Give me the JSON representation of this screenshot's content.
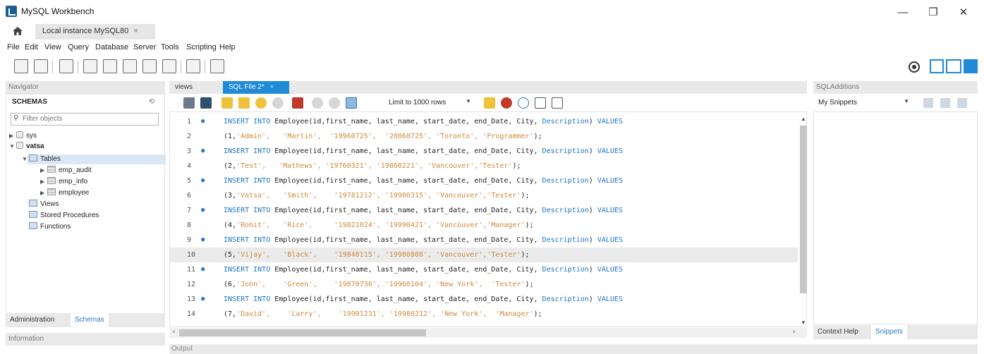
{
  "window": {
    "title": "MySQL Workbench",
    "minimize": "—",
    "maximize": "❐",
    "close": "✕"
  },
  "connection_tab": {
    "label": "Local instance MySQL80",
    "close": "×"
  },
  "menu": [
    "File",
    "Edit",
    "View",
    "Query",
    "Database",
    "Server",
    "Tools",
    "Scripting",
    "Help"
  ],
  "navigator": {
    "header": "Navigator",
    "schemas_title": "SCHEMAS",
    "filter_placeholder": "Filter objects",
    "tree": {
      "sys": "sys",
      "vatsa": "vatsa",
      "tables": "Tables",
      "emp_audit": "emp_audit",
      "emp_info": "emp_info",
      "employee": "employee",
      "views": "Views",
      "stored_procedures": "Stored Procedures",
      "functions": "Functions"
    },
    "tabs": {
      "administration": "Administration",
      "schemas": "Schemas"
    },
    "information": "Information"
  },
  "editor_tabs": {
    "views": "views",
    "sql_file": "SQL File 2*",
    "close": "×"
  },
  "editor_toolbar": {
    "limit": "Limit to 1000 rows"
  },
  "sql": {
    "insert_kw": "INSERT INTO",
    "insert_rest": " Employee(id,first_name, last_name, start_date, end_Date, City, ",
    "description_kw": "Description",
    "values_kw": "VALUES",
    "lines": [
      {
        "num": "1",
        "dot": true
      },
      {
        "num": "2",
        "id": "(1,",
        "vals": [
          "'Admin',",
          "   'Martin',",
          "  '19960725',",
          "  '20060725',",
          " 'Toronto',",
          " 'Programmer'"
        ],
        "end": ");"
      },
      {
        "num": "3",
        "dot": true
      },
      {
        "num": "4",
        "id": "(2,",
        "vals": [
          "'Test',",
          "   'Mathews',",
          " '19760321',",
          " '19860221',",
          " 'Vancouver',",
          "'Tester'"
        ],
        "end": ");"
      },
      {
        "num": "5",
        "dot": true
      },
      {
        "num": "6",
        "id": "(3,",
        "vals": [
          "'Vatsa',",
          "   'Smith',",
          "    '19781212',",
          " '19900315',",
          " 'Vancouver',",
          "'Tester'"
        ],
        "end": ");"
      },
      {
        "num": "7",
        "dot": true
      },
      {
        "num": "8",
        "id": "(4,",
        "vals": [
          "'Rohit',",
          "   'Rice',",
          "     '19821024',",
          " '19990421',",
          " 'Vancouver',",
          "'Manager'"
        ],
        "end": ");"
      },
      {
        "num": "9",
        "dot": true
      },
      {
        "num": "10",
        "id": "(5,",
        "vals": [
          "'Vijay',",
          "   'Black',",
          "    '19840115',",
          " '19980808',",
          " 'Vancouver',",
          "'Tester'"
        ],
        "end": ");"
      },
      {
        "num": "11",
        "dot": true
      },
      {
        "num": "12",
        "id": "(6,",
        "vals": [
          "'John',",
          "    'Green',",
          "    '19870730',",
          " '19960104',",
          " 'New York',",
          "  'Tester'"
        ],
        "end": ");"
      },
      {
        "num": "13",
        "dot": true
      },
      {
        "num": "14",
        "id": "(7,",
        "vals": [
          "'David',",
          "    'Larry',",
          "    '19901231',",
          " '19980212',",
          " 'New York',",
          "  'Manager'"
        ],
        "end": ");"
      }
    ]
  },
  "sql_additions": {
    "header": "SQLAdditions",
    "snippets_select": "My Snippets",
    "tabs": {
      "context_help": "Context Help",
      "snippets": "Snippets"
    }
  },
  "output": {
    "header": "Output"
  },
  "colors": {
    "accent": "#1f8ad5",
    "keyword": "#1b74c5",
    "string": "#ce8a3c"
  }
}
